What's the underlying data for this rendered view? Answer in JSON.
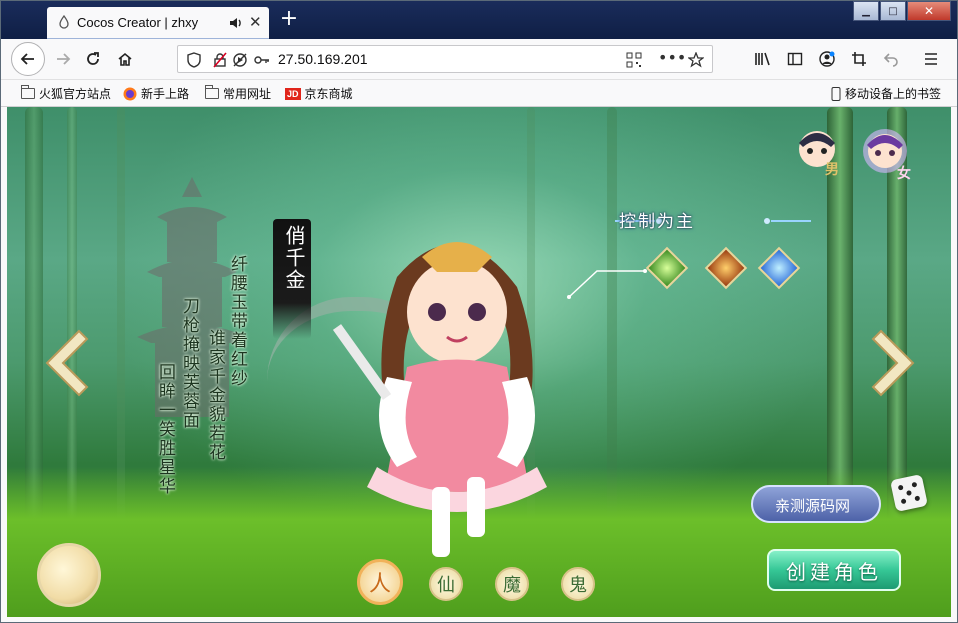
{
  "browser": {
    "tab_title": "Cocos Creator | zhxy",
    "new_tab_label": "+",
    "url": "27.50.169.201"
  },
  "bookmarks": [
    {
      "label": "火狐官方站点",
      "icon": "folder-icon"
    },
    {
      "label": "新手上路",
      "icon": "firefox-icon"
    },
    {
      "label": "常用网址",
      "icon": "folder-icon"
    },
    {
      "label": "京东商城",
      "icon": "jd-icon",
      "icon_text": "JD"
    }
  ],
  "mobile_bookmarks": "移动设备上的书签",
  "game": {
    "character_name": "俏千金",
    "poem_lines": [
      "纤腰玉带着红纱",
      "谁家千金貌若花",
      "刀枪掩映芙蓉面",
      "回眸一笑胜星华"
    ],
    "role_tag": "控制为主",
    "gender_male": "男",
    "gender_female": "女",
    "factions": [
      "人",
      "仙",
      "魔",
      "鬼"
    ],
    "random_name_label": "亲测源码网",
    "create_button_label": "创建角色"
  },
  "colors": {
    "tabbar_bg": "#1a2c5b",
    "create_button": "#36c796",
    "faction_active": "#f1b25a",
    "jd_red": "#e1251b"
  }
}
